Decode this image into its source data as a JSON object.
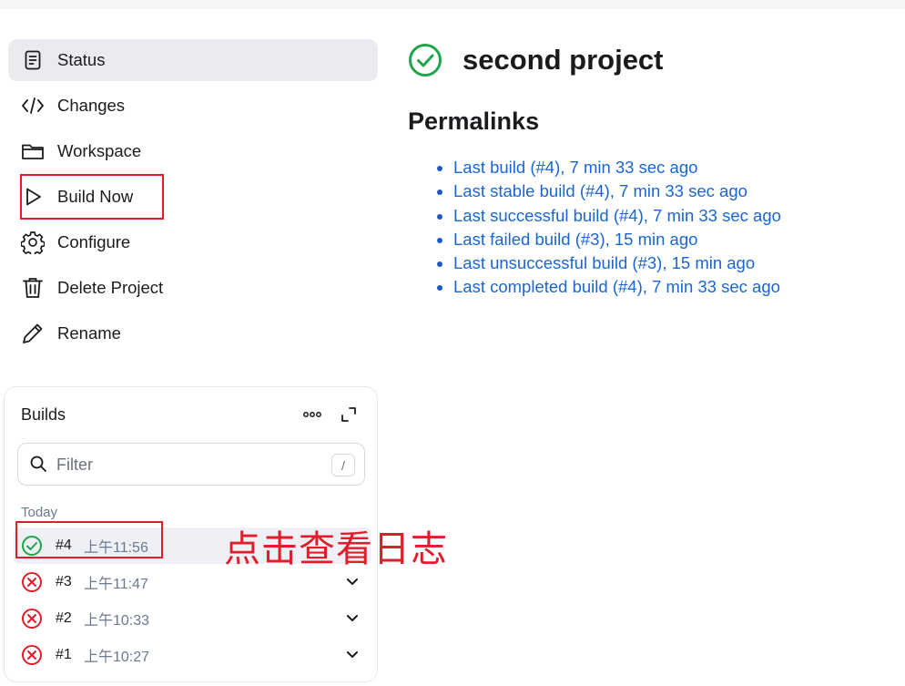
{
  "nav": {
    "items": [
      {
        "label": "Status",
        "icon": "document-icon"
      },
      {
        "label": "Changes",
        "icon": "code-icon"
      },
      {
        "label": "Workspace",
        "icon": "folder-icon"
      },
      {
        "label": "Build Now",
        "icon": "play-icon"
      },
      {
        "label": "Configure",
        "icon": "gear-icon"
      },
      {
        "label": "Delete Project",
        "icon": "trash-icon"
      },
      {
        "label": "Rename",
        "icon": "pencil-icon"
      }
    ]
  },
  "builds": {
    "title": "Builds",
    "filter_placeholder": "Filter",
    "filter_shortcut": "/",
    "group_label": "Today",
    "rows": [
      {
        "number": "#4",
        "time": "上午11:56",
        "status": "success"
      },
      {
        "number": "#3",
        "time": "上午11:47",
        "status": "failed"
      },
      {
        "number": "#2",
        "time": "上午10:33",
        "status": "failed"
      },
      {
        "number": "#1",
        "time": "上午10:27",
        "status": "failed"
      }
    ]
  },
  "main": {
    "title": "second project",
    "permalinks_heading": "Permalinks",
    "permalinks": [
      "Last build (#4), 7 min 33 sec ago",
      "Last stable build (#4), 7 min 33 sec ago",
      "Last successful build (#4), 7 min 33 sec ago",
      "Last failed build (#3), 15 min ago",
      "Last unsuccessful build (#3), 15 min ago",
      "Last completed build (#4), 7 min 33 sec ago"
    ]
  },
  "annotation": {
    "text": "点击查看日志"
  },
  "colors": {
    "success": "#1ea64b",
    "failed": "#e11d2b",
    "link": "#1a66d2",
    "annotation": "#e11d2b"
  }
}
